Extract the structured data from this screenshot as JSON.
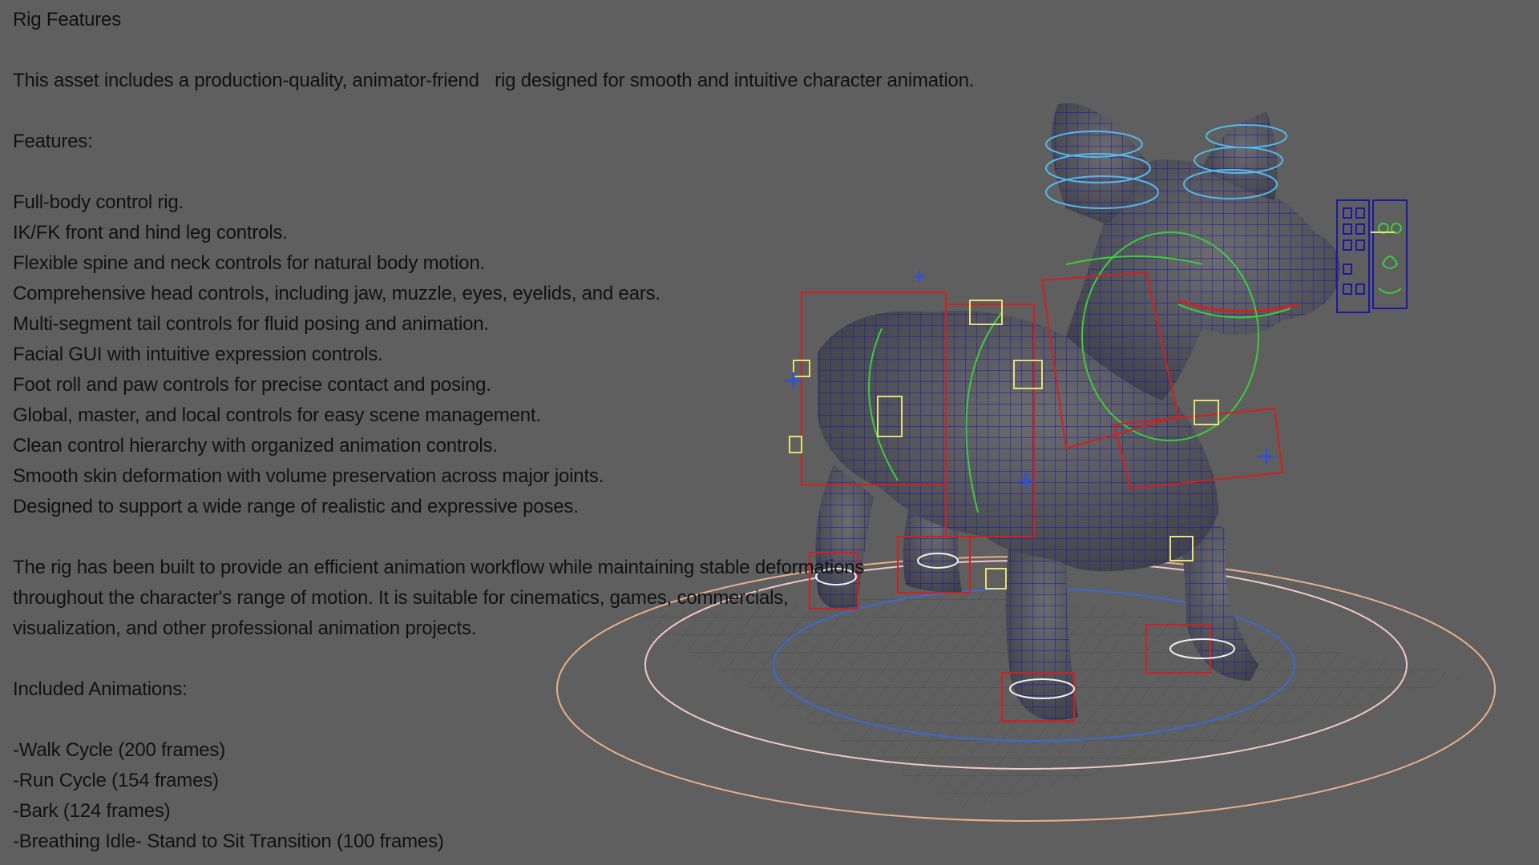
{
  "title": "Rig Features",
  "intro": "This asset includes a production-quality, animator-friend   rig designed for smooth and intuitive character animation.",
  "features_heading": "Features:",
  "features": [
    "Full-body control rig.",
    "IK/FK front and hind leg controls.",
    "Flexible spine and neck controls for natural body motion.",
    "Comprehensive head controls, including jaw, muzzle, eyes, eyelids, and ears.",
    "Multi-segment tail controls for fluid posing and animation.",
    "Facial GUI with intuitive expression controls.",
    "Foot roll and paw controls for precise contact and posing.",
    "Global, master, and local controls for easy scene management.",
    "Clean control hierarchy with organized animation controls.",
    "Smooth skin deformation with volume preservation across major joints.",
    "Designed to support a wide range of realistic and expressive poses."
  ],
  "summary": [
    "The rig has been built to provide an efficient animation workflow while maintaining stable deformations",
    "throughout the character's range of motion. It is suitable for cinematics, games, commercials,",
    "visualization, and other professional animation projects."
  ],
  "animations_heading": "Included Animations:",
  "animations": [
    "-Walk Cycle (200 frames)",
    "-Run Cycle (154 frames)",
    "-Bark (124 frames)",
    "-Breathing Idle- Stand to Sit Transition (100 frames)"
  ],
  "colors": {
    "background": "#5f5f5f",
    "wireframe": "#1a1aa0",
    "control_red": "#d22020",
    "control_green": "#3ccc3c",
    "control_cyan": "#55b8e8",
    "control_yellow": "#e8e070",
    "control_blue": "#3050d8",
    "ring_outer": "#e8b08a",
    "ring_mid": "#f0c8c8",
    "ring_inner": "#3a6ad0"
  }
}
